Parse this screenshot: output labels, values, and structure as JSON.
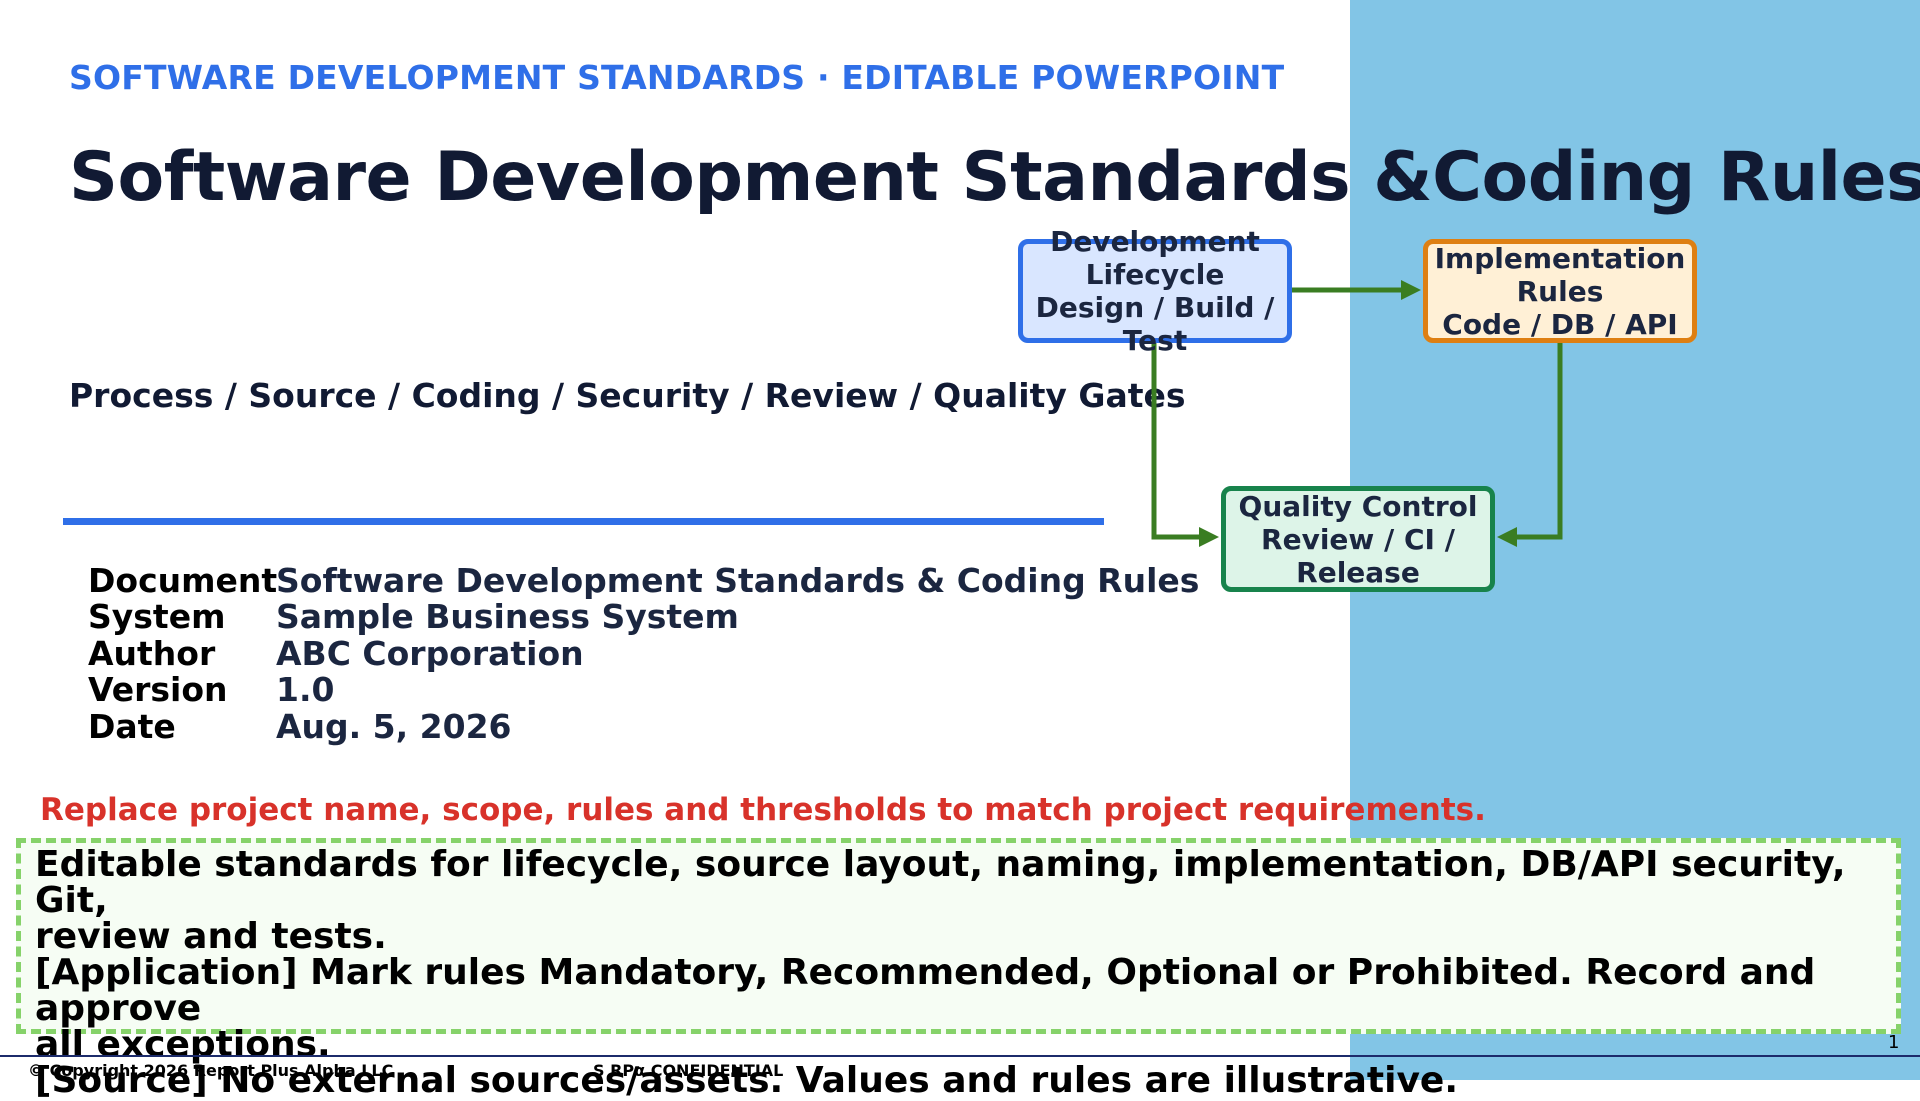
{
  "slide": {
    "kicker": "SOFTWARE DEVELOPMENT STANDARDS · EDITABLE POWERPOINT",
    "title": "Software Development Standards &Coding Rules",
    "subtitle": "Process / Source / Coding / Security / Review / Quality Gates"
  },
  "meta": [
    {
      "key": "Document",
      "value": "Software Development Standards & Coding Rules"
    },
    {
      "key": "System",
      "value": "Sample Business System"
    },
    {
      "key": "Author",
      "value": "ABC Corporation"
    },
    {
      "key": "Version",
      "value": "1.0"
    },
    {
      "key": "Date",
      "value": "Aug. 5, 2026"
    }
  ],
  "flow": {
    "lifecycle": {
      "line1": "Development",
      "line2": "Lifecycle",
      "line3": "Design / Build /",
      "line4": "Test"
    },
    "implementation": {
      "line1": "Implementation",
      "line2": "Rules",
      "line3": "Code / DB / API"
    },
    "quality": {
      "line1": "Quality Control",
      "line2": "Review / CI /",
      "line3": "Release"
    }
  },
  "notice": "Replace project name, scope, rules and thresholds to match project requirements.",
  "info": {
    "line1": "Editable standards for lifecycle, source layout, naming, implementation, DB/API security, Git,",
    "line2": "review and tests.",
    "line3": "[Application] Mark rules Mandatory, Recommended, Optional or Prohibited. Record and approve",
    "line4": "all exceptions.",
    "line5": "[Source] No external sources/assets. Values and rules are illustrative."
  },
  "footer": {
    "copyright": "© Copyright 2026 Report Plus Alpha LLC",
    "confidential": "S RPα CONFIDENTIAL",
    "page": "1"
  },
  "colors": {
    "accent_blue": "#2f6fe8",
    "panel_blue": "#82c5e6",
    "arrow_green": "#3a7d22",
    "notice_red": "#d8322a",
    "dashed_green": "#86d26a"
  }
}
